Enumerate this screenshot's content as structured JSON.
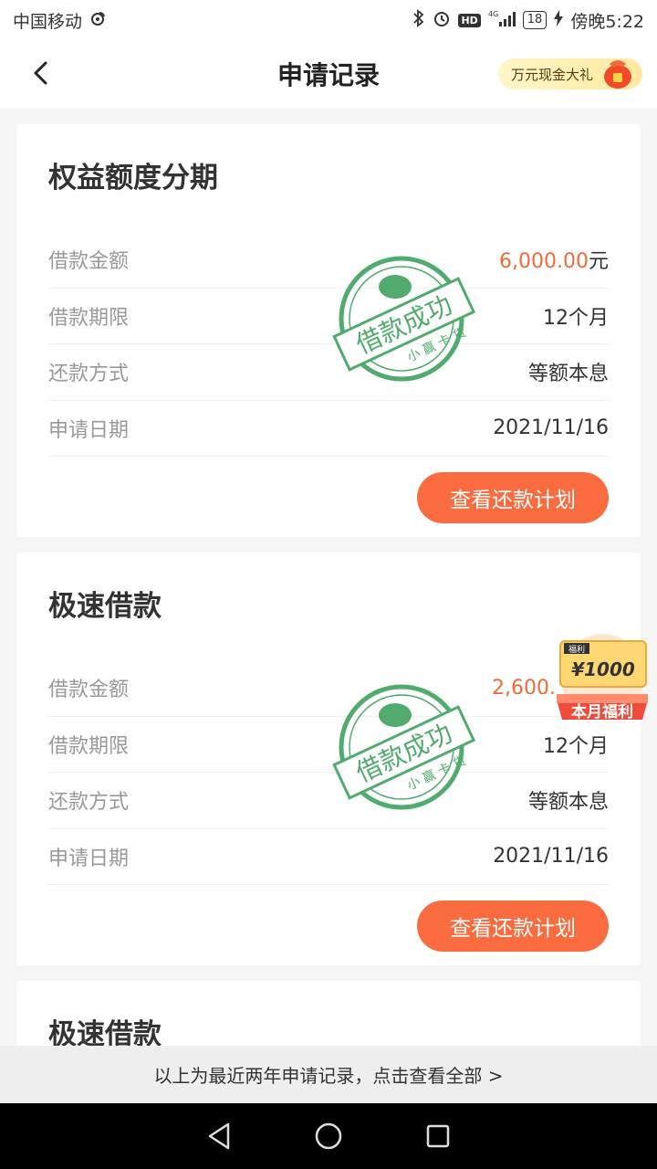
{
  "status_bar": {
    "carrier": "中国移动",
    "hd": "HD",
    "network": "4G",
    "battery": "18",
    "time": "傍晚5:22"
  },
  "header": {
    "title": "申请记录",
    "promo": "万元现金大礼"
  },
  "records": [
    {
      "title": "权益额度分期",
      "amount_label": "借款金额",
      "amount_value": "6,000.00",
      "amount_unit": "元",
      "term_label": "借款期限",
      "term_value": "12个月",
      "method_label": "还款方式",
      "method_value": "等额本息",
      "date_label": "申请日期",
      "date_value": "2021/11/16",
      "button": "查看还款计划",
      "stamp_text": "借款成功",
      "stamp_sub": "小 赢 卡 贷"
    },
    {
      "title": "极速借款",
      "amount_label": "借款金额",
      "amount_value": "2,600.",
      "amount_unit": "",
      "term_label": "借款期限",
      "term_value": "12个月",
      "method_label": "还款方式",
      "method_value": "等额本息",
      "date_label": "申请日期",
      "date_value": "2021/11/16",
      "button": "查看还款计划",
      "stamp_text": "借款成功",
      "stamp_sub": "小 赢 卡 贷"
    },
    {
      "title": "极速借款"
    }
  ],
  "float_widget": {
    "tag": "福利",
    "amount": "¥1000",
    "label": "本月福利"
  },
  "footer": {
    "notice": "以上为最近两年申请记录，点击查看全部 >"
  },
  "colors": {
    "accent": "#fa6c3f",
    "amount": "#f06a36",
    "stamp": "#3fa25f"
  }
}
